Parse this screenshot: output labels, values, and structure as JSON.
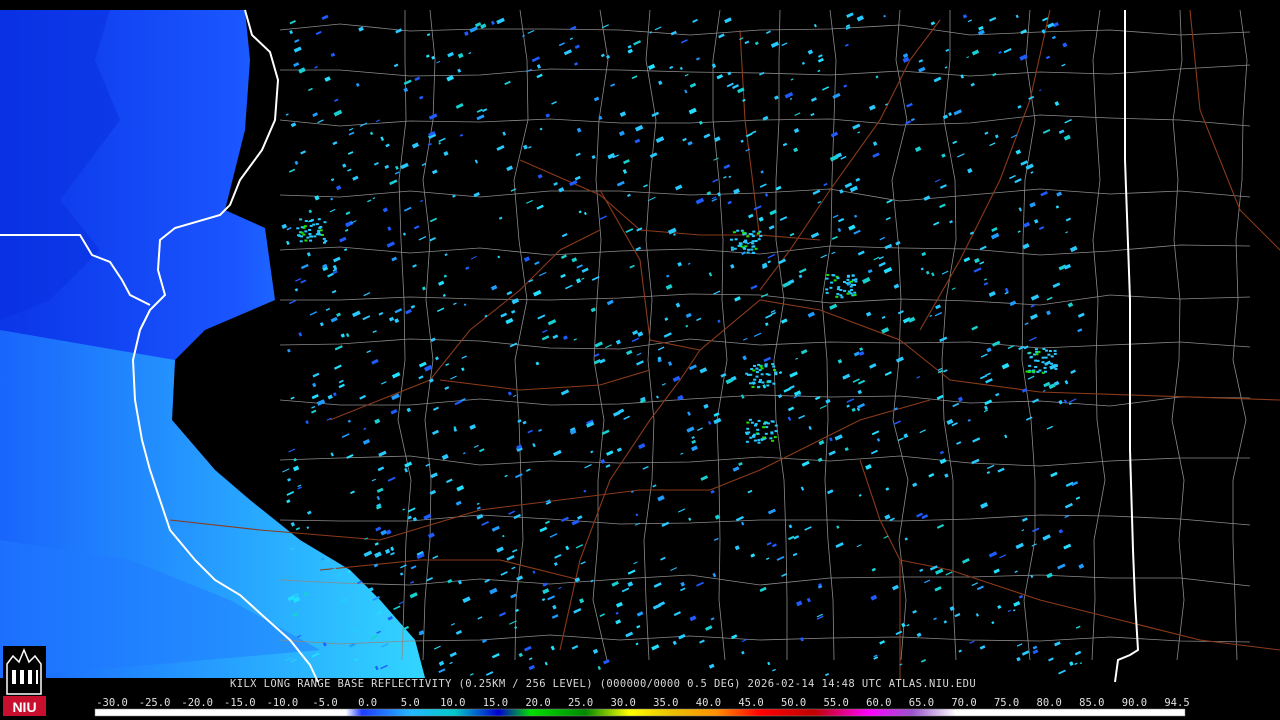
{
  "caption": "KILX LONG RANGE BASE REFLECTIVITY (0.25KM / 256 LEVEL) (000000/0000 0.5 DEG) 2026-02-14 14:48 UTC  ATLAS.NIU.EDU",
  "logo_text": "NIU",
  "colors": {
    "background": "#000000",
    "state_border": "#ffffff",
    "county_border": "#8a8a8a",
    "road": "#8b3a1a",
    "clear_air_echo": "#1f5cff",
    "light_echo": "#27c9ff",
    "logo_red": "#c8102e"
  },
  "scale": {
    "labels": [
      "-30.0",
      "-25.0",
      "-20.0",
      "-15.0",
      "-10.0",
      "-5.0",
      "0.0",
      "5.0",
      "10.0",
      "15.0",
      "20.0",
      "25.0",
      "30.0",
      "35.0",
      "40.0",
      "45.0",
      "50.0",
      "55.0",
      "60.0",
      "65.0",
      "70.0",
      "75.0",
      "80.0",
      "85.0",
      "90.0",
      "94.5"
    ],
    "stops": [
      {
        "dbz": -30,
        "color": "#ffffff"
      },
      {
        "dbz": -25,
        "color": "#ffffff"
      },
      {
        "dbz": -20,
        "color": "#ffffff"
      },
      {
        "dbz": -15,
        "color": "#ffffff"
      },
      {
        "dbz": -10,
        "color": "#ffffff"
      },
      {
        "dbz": -5,
        "color": "#e8e8e8"
      },
      {
        "dbz": 0,
        "color": "#1f3cff"
      },
      {
        "dbz": 5,
        "color": "#24b8ff"
      },
      {
        "dbz": 10,
        "color": "#00c8c8"
      },
      {
        "dbz": 15,
        "color": "#0000d0"
      },
      {
        "dbz": 20,
        "color": "#00e000"
      },
      {
        "dbz": 25,
        "color": "#00b000"
      },
      {
        "dbz": 30,
        "color": "#008800"
      },
      {
        "dbz": 35,
        "color": "#ffff00"
      },
      {
        "dbz": 40,
        "color": "#e8c000"
      },
      {
        "dbz": 45,
        "color": "#ff9000"
      },
      {
        "dbz": 50,
        "color": "#ff0000"
      },
      {
        "dbz": 55,
        "color": "#d00000"
      },
      {
        "dbz": 60,
        "color": "#c00000"
      },
      {
        "dbz": 65,
        "color": "#ff00ff"
      },
      {
        "dbz": 70,
        "color": "#9955cc"
      },
      {
        "dbz": 75,
        "color": "#ffffff"
      },
      {
        "dbz": 80,
        "color": "#ffffff"
      },
      {
        "dbz": 85,
        "color": "#ffffff"
      },
      {
        "dbz": 90,
        "color": "#ffffff"
      },
      {
        "dbz": 94.5,
        "color": "#ffffff"
      }
    ]
  }
}
